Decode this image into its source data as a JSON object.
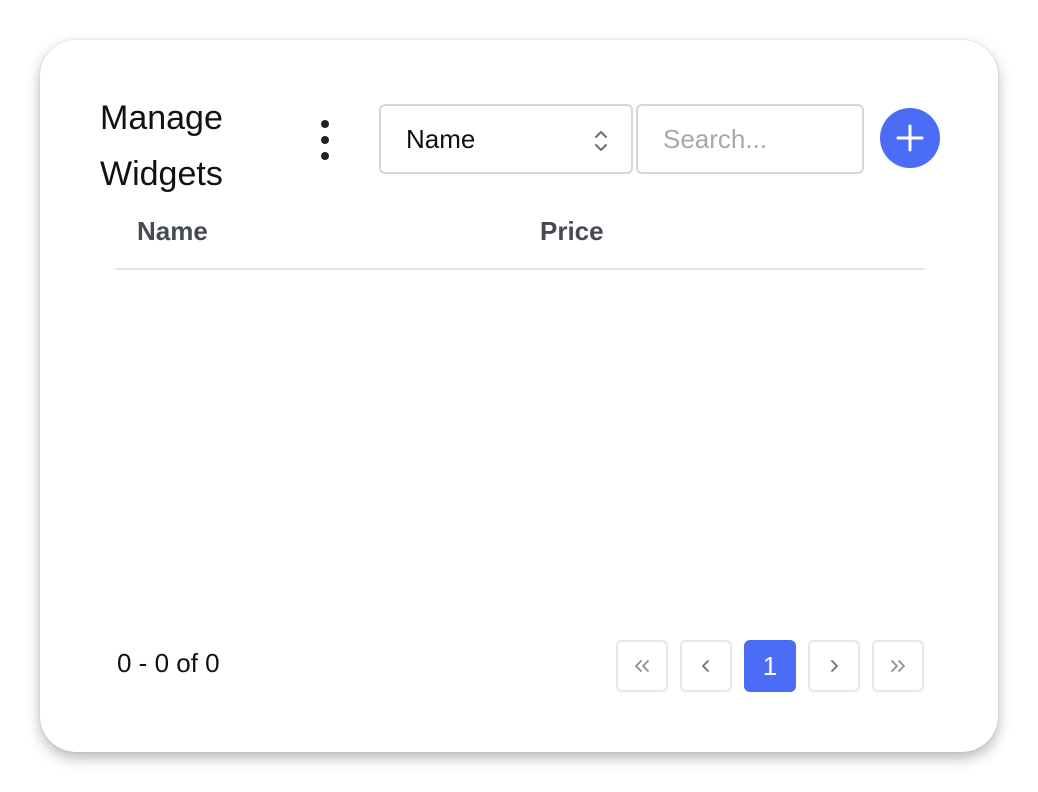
{
  "header": {
    "title": "Manage Widgets",
    "menu_icon": "more-vertical-icon",
    "sort_select": {
      "selected": "Name",
      "icon": "chevron-up-down-icon"
    },
    "search": {
      "value": "",
      "placeholder": "Search..."
    },
    "add_button": {
      "icon": "plus-icon",
      "color": "#4b6cf5"
    }
  },
  "table": {
    "columns": [
      "Name",
      "Price"
    ],
    "rows": []
  },
  "footer": {
    "range_text": "0 - 0 of 0",
    "pagination": {
      "first_icon": "chevrons-left-icon",
      "prev_icon": "chevron-left-icon",
      "current_page": "1",
      "next_icon": "chevron-right-icon",
      "last_icon": "chevrons-right-icon",
      "active_color": "#4b6cf5"
    }
  }
}
